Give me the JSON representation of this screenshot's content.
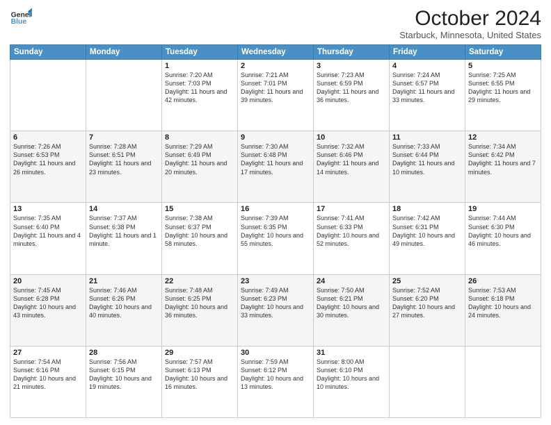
{
  "header": {
    "logo_line1": "General",
    "logo_line2": "Blue",
    "month_title": "October 2024",
    "location": "Starbuck, Minnesota, United States"
  },
  "days_of_week": [
    "Sunday",
    "Monday",
    "Tuesday",
    "Wednesday",
    "Thursday",
    "Friday",
    "Saturday"
  ],
  "weeks": [
    [
      {
        "num": "",
        "info": ""
      },
      {
        "num": "",
        "info": ""
      },
      {
        "num": "1",
        "info": "Sunrise: 7:20 AM\nSunset: 7:03 PM\nDaylight: 11 hours and 42 minutes."
      },
      {
        "num": "2",
        "info": "Sunrise: 7:21 AM\nSunset: 7:01 PM\nDaylight: 11 hours and 39 minutes."
      },
      {
        "num": "3",
        "info": "Sunrise: 7:23 AM\nSunset: 6:59 PM\nDaylight: 11 hours and 36 minutes."
      },
      {
        "num": "4",
        "info": "Sunrise: 7:24 AM\nSunset: 6:57 PM\nDaylight: 11 hours and 33 minutes."
      },
      {
        "num": "5",
        "info": "Sunrise: 7:25 AM\nSunset: 6:55 PM\nDaylight: 11 hours and 29 minutes."
      }
    ],
    [
      {
        "num": "6",
        "info": "Sunrise: 7:26 AM\nSunset: 6:53 PM\nDaylight: 11 hours and 26 minutes."
      },
      {
        "num": "7",
        "info": "Sunrise: 7:28 AM\nSunset: 6:51 PM\nDaylight: 11 hours and 23 minutes."
      },
      {
        "num": "8",
        "info": "Sunrise: 7:29 AM\nSunset: 6:49 PM\nDaylight: 11 hours and 20 minutes."
      },
      {
        "num": "9",
        "info": "Sunrise: 7:30 AM\nSunset: 6:48 PM\nDaylight: 11 hours and 17 minutes."
      },
      {
        "num": "10",
        "info": "Sunrise: 7:32 AM\nSunset: 6:46 PM\nDaylight: 11 hours and 14 minutes."
      },
      {
        "num": "11",
        "info": "Sunrise: 7:33 AM\nSunset: 6:44 PM\nDaylight: 11 hours and 10 minutes."
      },
      {
        "num": "12",
        "info": "Sunrise: 7:34 AM\nSunset: 6:42 PM\nDaylight: 11 hours and 7 minutes."
      }
    ],
    [
      {
        "num": "13",
        "info": "Sunrise: 7:35 AM\nSunset: 6:40 PM\nDaylight: 11 hours and 4 minutes."
      },
      {
        "num": "14",
        "info": "Sunrise: 7:37 AM\nSunset: 6:38 PM\nDaylight: 11 hours and 1 minute."
      },
      {
        "num": "15",
        "info": "Sunrise: 7:38 AM\nSunset: 6:37 PM\nDaylight: 10 hours and 58 minutes."
      },
      {
        "num": "16",
        "info": "Sunrise: 7:39 AM\nSunset: 6:35 PM\nDaylight: 10 hours and 55 minutes."
      },
      {
        "num": "17",
        "info": "Sunrise: 7:41 AM\nSunset: 6:33 PM\nDaylight: 10 hours and 52 minutes."
      },
      {
        "num": "18",
        "info": "Sunrise: 7:42 AM\nSunset: 6:31 PM\nDaylight: 10 hours and 49 minutes."
      },
      {
        "num": "19",
        "info": "Sunrise: 7:44 AM\nSunset: 6:30 PM\nDaylight: 10 hours and 46 minutes."
      }
    ],
    [
      {
        "num": "20",
        "info": "Sunrise: 7:45 AM\nSunset: 6:28 PM\nDaylight: 10 hours and 43 minutes."
      },
      {
        "num": "21",
        "info": "Sunrise: 7:46 AM\nSunset: 6:26 PM\nDaylight: 10 hours and 40 minutes."
      },
      {
        "num": "22",
        "info": "Sunrise: 7:48 AM\nSunset: 6:25 PM\nDaylight: 10 hours and 36 minutes."
      },
      {
        "num": "23",
        "info": "Sunrise: 7:49 AM\nSunset: 6:23 PM\nDaylight: 10 hours and 33 minutes."
      },
      {
        "num": "24",
        "info": "Sunrise: 7:50 AM\nSunset: 6:21 PM\nDaylight: 10 hours and 30 minutes."
      },
      {
        "num": "25",
        "info": "Sunrise: 7:52 AM\nSunset: 6:20 PM\nDaylight: 10 hours and 27 minutes."
      },
      {
        "num": "26",
        "info": "Sunrise: 7:53 AM\nSunset: 6:18 PM\nDaylight: 10 hours and 24 minutes."
      }
    ],
    [
      {
        "num": "27",
        "info": "Sunrise: 7:54 AM\nSunset: 6:16 PM\nDaylight: 10 hours and 21 minutes."
      },
      {
        "num": "28",
        "info": "Sunrise: 7:56 AM\nSunset: 6:15 PM\nDaylight: 10 hours and 19 minutes."
      },
      {
        "num": "29",
        "info": "Sunrise: 7:57 AM\nSunset: 6:13 PM\nDaylight: 10 hours and 16 minutes."
      },
      {
        "num": "30",
        "info": "Sunrise: 7:59 AM\nSunset: 6:12 PM\nDaylight: 10 hours and 13 minutes."
      },
      {
        "num": "31",
        "info": "Sunrise: 8:00 AM\nSunset: 6:10 PM\nDaylight: 10 hours and 10 minutes."
      },
      {
        "num": "",
        "info": ""
      },
      {
        "num": "",
        "info": ""
      }
    ]
  ]
}
